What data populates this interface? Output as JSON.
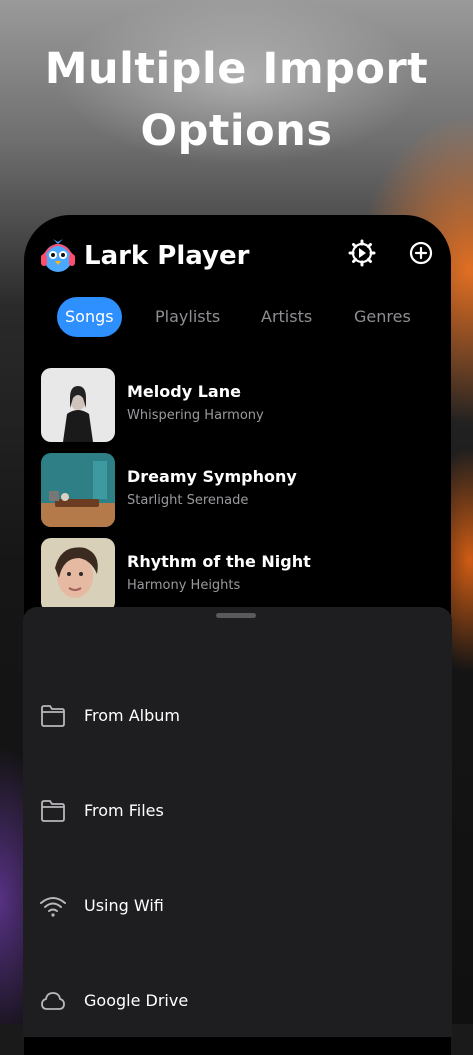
{
  "promo": {
    "headline_line1": "Multiple Import",
    "headline_line2": "Options"
  },
  "app": {
    "title": "Lark Player",
    "accent_color": "#2e8fff",
    "header_icons": [
      "settings-icon",
      "add-icon"
    ]
  },
  "tabs": [
    {
      "label": "Songs",
      "active": true
    },
    {
      "label": "Playlists",
      "active": false
    },
    {
      "label": "Artists",
      "active": false
    },
    {
      "label": "Genres",
      "active": false
    }
  ],
  "songs": [
    {
      "title": "Melody Lane",
      "artist": "Whispering Harmony"
    },
    {
      "title": "Dreamy Symphony",
      "artist": "Starlight Serenade"
    },
    {
      "title": "Rhythm of the Night",
      "artist": "Harmony Heights"
    }
  ],
  "import_sheet": {
    "options": [
      {
        "label": "From Album",
        "icon": "folder-icon"
      },
      {
        "label": "From Files",
        "icon": "folder-icon"
      },
      {
        "label": "Using Wifi",
        "icon": "wifi-icon"
      },
      {
        "label": "Google Drive",
        "icon": "cloud-icon"
      }
    ]
  }
}
